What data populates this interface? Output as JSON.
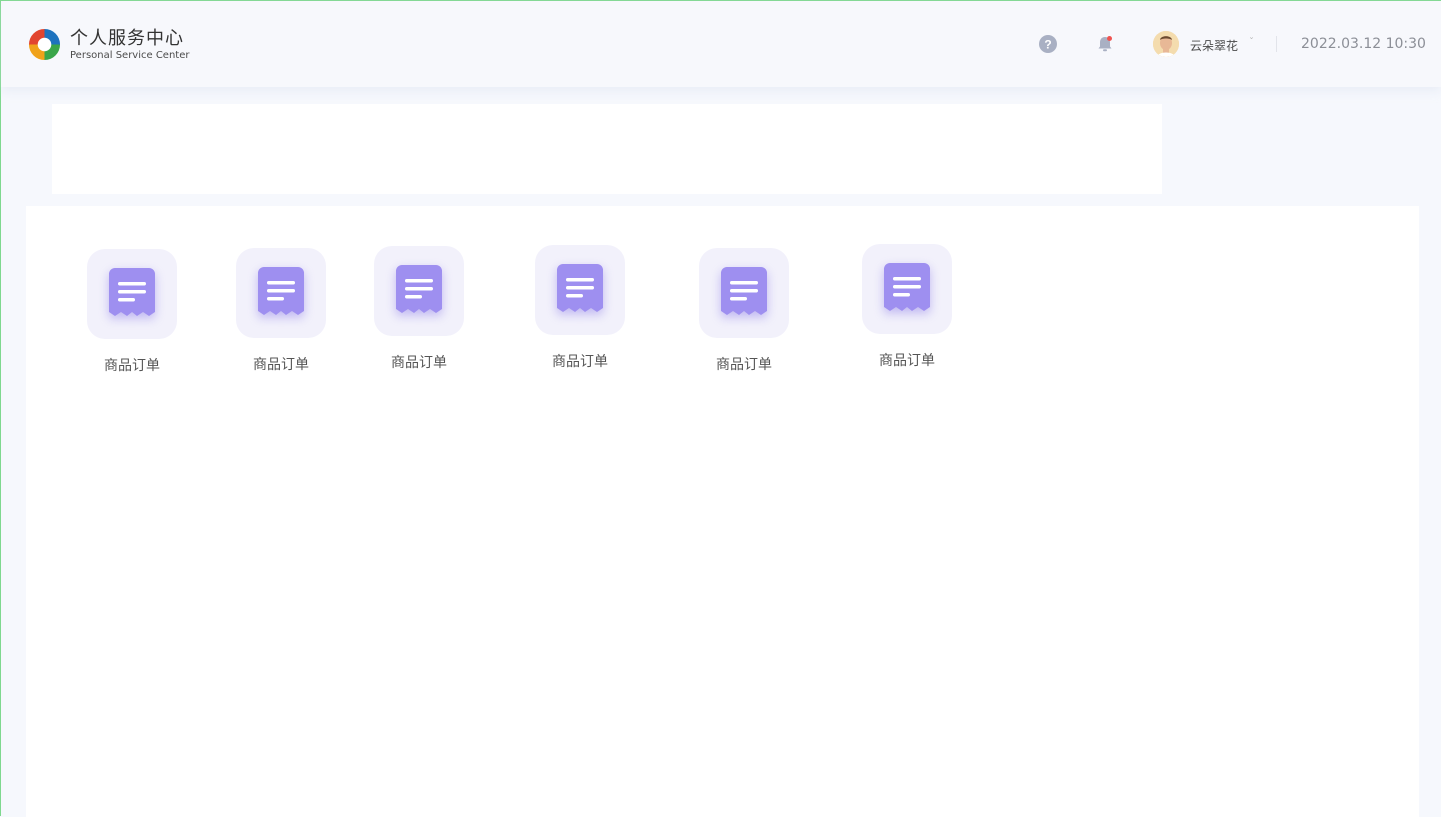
{
  "header": {
    "title_cn": "个人服务中心",
    "title_en": "Personal Service Center",
    "help_icon": "help-icon",
    "bell_icon": "bell-icon",
    "username": "云朵翠花",
    "caret": "ˇ",
    "datetime": "2022.03.12 10:30"
  },
  "apps": [
    {
      "label": "商品订单",
      "icon": "receipt-icon"
    },
    {
      "label": "商品订单",
      "icon": "receipt-icon"
    },
    {
      "label": "商品订单",
      "icon": "receipt-icon"
    },
    {
      "label": "商品订单",
      "icon": "receipt-icon"
    },
    {
      "label": "商品订单",
      "icon": "receipt-icon"
    },
    {
      "label": "商品订单",
      "icon": "receipt-icon"
    }
  ],
  "colors": {
    "accent": "#9e8ff0",
    "tile_bg": "#f2f1fb",
    "page_bg": "#f6f8fd"
  }
}
